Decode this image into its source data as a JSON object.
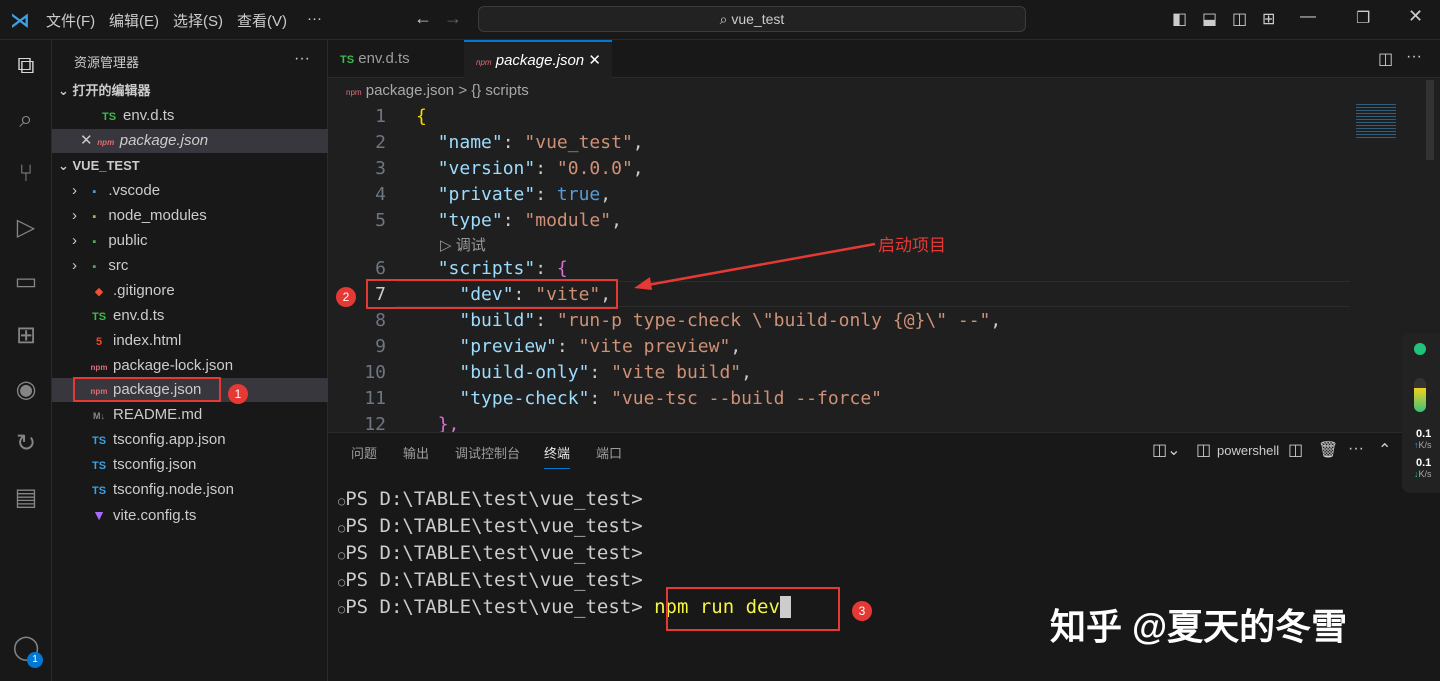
{
  "titlebar": {
    "menus": [
      "文件(F)",
      "编辑(E)",
      "选择(S)",
      "查看(V)",
      "···"
    ],
    "search": "vue_test"
  },
  "sidebar": {
    "title": "资源管理器",
    "more": "···",
    "open_editors_label": "打开的编辑器",
    "open_editors": [
      {
        "icon": "TS",
        "name": "env.d.ts"
      },
      {
        "icon": "npm",
        "name": "package.json"
      }
    ],
    "project": "VUE_TEST",
    "folders": [
      ".vscode",
      "node_modules",
      "public",
      "src"
    ],
    "files": [
      {
        "icon": "git",
        "name": ".gitignore"
      },
      {
        "icon": "TS",
        "name": "env.d.ts"
      },
      {
        "icon": "html",
        "name": "index.html"
      },
      {
        "icon": "npm",
        "name": "package-lock.json"
      },
      {
        "icon": "npm",
        "name": "package.json"
      },
      {
        "icon": "M↓",
        "name": "README.md"
      },
      {
        "icon": "TS",
        "name": "tsconfig.app.json"
      },
      {
        "icon": "TS",
        "name": "tsconfig.json"
      },
      {
        "icon": "TS",
        "name": "tsconfig.node.json"
      },
      {
        "icon": "vite",
        "name": "vite.config.ts"
      }
    ]
  },
  "tabs": [
    {
      "label": "env.d.ts",
      "icon": "TS"
    },
    {
      "label": "package.json",
      "icon": "npm",
      "close": "✕"
    }
  ],
  "breadcrumb": {
    "file": "package.json",
    "sep": ">",
    "symbol": "{} scripts"
  },
  "editor": {
    "line_numbers": [
      "1",
      "2",
      "3",
      "4",
      "5",
      "6",
      "7",
      "8",
      "9",
      "10",
      "11",
      "12"
    ],
    "codelens": "▷ 调试"
  },
  "panel": {
    "tabs": [
      "问题",
      "输出",
      "调试控制台",
      "终端",
      "端口"
    ],
    "active": "终端",
    "shell": "powershell",
    "terminal": [
      "PS D:\\TABLE\\test\\vue_test>",
      "PS D:\\TABLE\\test\\vue_test>",
      "PS D:\\TABLE\\test\\vue_test>",
      "PS D:\\TABLE\\test\\vue_test>",
      "PS D:\\TABLE\\test\\vue_test>"
    ],
    "command": "npm run dev"
  },
  "annotations": {
    "label": "启动项目",
    "b1": "1",
    "b2": "2",
    "b3": "3"
  },
  "net": {
    "up": "0.1",
    "up_unit": "K/s",
    "down": "0.1",
    "down_unit": "K/s"
  },
  "account_badge": "1",
  "watermark": "知乎 @夏天的冬雪"
}
